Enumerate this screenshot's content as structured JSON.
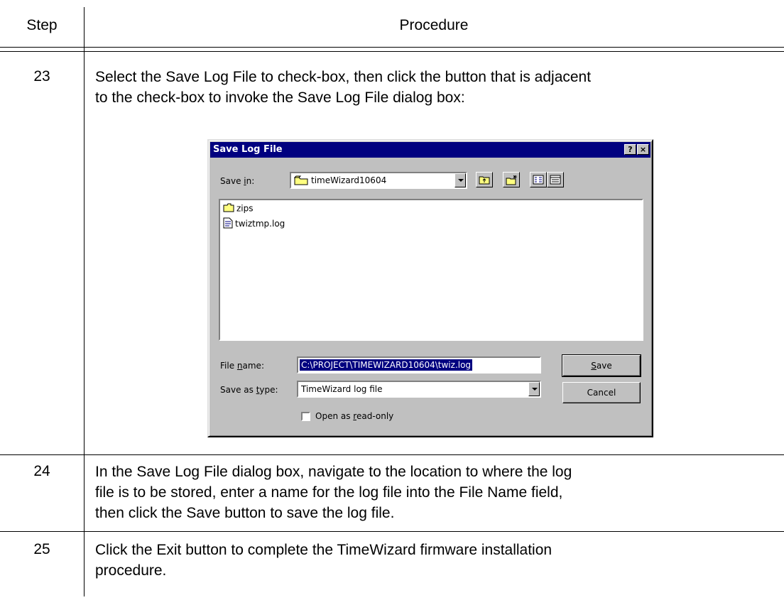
{
  "table": {
    "header_step": "Step",
    "header_procedure": "Procedure",
    "rows": [
      {
        "step": "23",
        "lines": [
          "Select the Save Log File to check-box, then click the button that is adjacent",
          "to the check-box to invoke the Save Log File dialog box:"
        ]
      },
      {
        "step": "24",
        "lines": [
          "In the Save Log File dialog box, navigate to the location to where the log",
          "file is to be stored, enter a name for the log file into the File Name field,",
          "then click the Save button to save the log file."
        ]
      },
      {
        "step": "25",
        "lines": [
          "Click the Exit button to complete the TimeWizard firmware installation",
          "procedure."
        ]
      }
    ]
  },
  "dialog": {
    "title": "Save Log File",
    "help_button": "?",
    "close_button": "×",
    "save_in_label_pre": "Save ",
    "save_in_label_u": "i",
    "save_in_label_post": "n:",
    "save_in_value": "timeWizard10604",
    "files": [
      "zips",
      "twiztmp.log"
    ],
    "file_name_label_pre": "File ",
    "file_name_label_u": "n",
    "file_name_label_post": "ame:",
    "file_name_value": "C:\\PROJECT\\TIMEWIZARD10604\\twiz.log",
    "save_type_label_pre": "Save as ",
    "save_type_label_u": "t",
    "save_type_label_post": "ype:",
    "save_type_value": "TimeWizard log file",
    "save_button_u": "S",
    "save_button_post": "ave",
    "cancel_button": "Cancel",
    "readonly_pre": "Open as ",
    "readonly_u": "r",
    "readonly_post": "ead-only",
    "icons": [
      "folder-icon",
      "up-folder-icon",
      "new-folder-icon",
      "list-view-icon",
      "details-view-icon",
      "text-file-icon"
    ]
  }
}
